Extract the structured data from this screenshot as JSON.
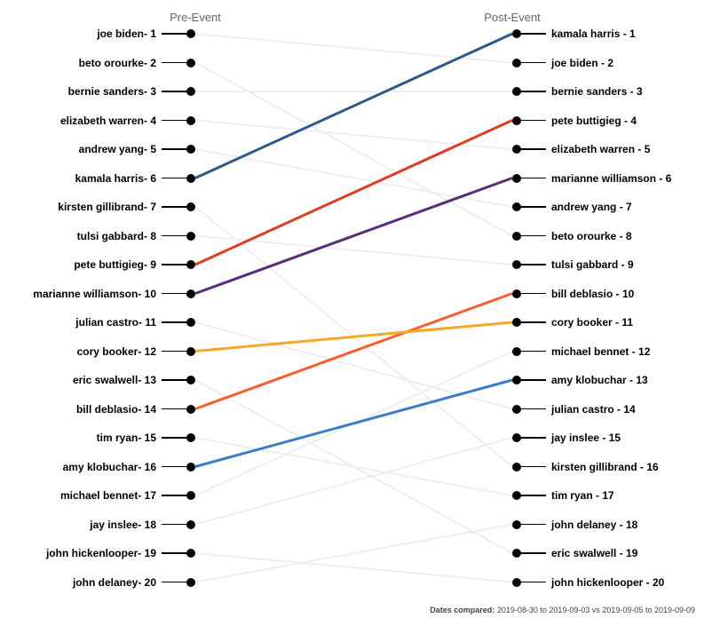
{
  "chart_data": {
    "type": "slope",
    "headers": {
      "pre": "Pre-Event",
      "post": "Post-Event"
    },
    "footer": {
      "label": "Dates compared:",
      "range": "2019-08-30 to 2019-09-03 vs 2019-09-05 to 2019-09-09"
    },
    "layout": {
      "leftX": 220,
      "rightX": 577,
      "topY": 38,
      "gap": 32.5
    },
    "highlights": [
      {
        "name": "kamala harris",
        "from": 6,
        "to": 1,
        "color": "#2d5a8c"
      },
      {
        "name": "pete buttigieg",
        "from": 9,
        "to": 4,
        "color": "#e23b22"
      },
      {
        "name": "marianne williamson",
        "from": 10,
        "to": 6,
        "color": "#5a2d7a"
      },
      {
        "name": "bill deblasio",
        "from": 14,
        "to": 10,
        "color": "#f75f2e"
      },
      {
        "name": "cory booker",
        "from": 12,
        "to": 11,
        "color": "#f7a728"
      },
      {
        "name": "amy klobuchar",
        "from": 16,
        "to": 13,
        "color": "#3b7dc9"
      }
    ],
    "pre": [
      {
        "name": "joe biden",
        "rank": 1
      },
      {
        "name": "beto orourke",
        "rank": 2
      },
      {
        "name": "bernie sanders",
        "rank": 3
      },
      {
        "name": "elizabeth warren",
        "rank": 4
      },
      {
        "name": "andrew yang",
        "rank": 5
      },
      {
        "name": "kamala harris",
        "rank": 6
      },
      {
        "name": "kirsten gillibrand",
        "rank": 7
      },
      {
        "name": "tulsi gabbard",
        "rank": 8
      },
      {
        "name": "pete buttigieg",
        "rank": 9
      },
      {
        "name": "marianne williamson",
        "rank": 10
      },
      {
        "name": "julian castro",
        "rank": 11
      },
      {
        "name": "cory booker",
        "rank": 12
      },
      {
        "name": "eric swalwell",
        "rank": 13
      },
      {
        "name": "bill deblasio",
        "rank": 14
      },
      {
        "name": "tim ryan",
        "rank": 15
      },
      {
        "name": "amy klobuchar",
        "rank": 16
      },
      {
        "name": "michael bennet",
        "rank": 17
      },
      {
        "name": "jay inslee",
        "rank": 18
      },
      {
        "name": "john hickenlooper",
        "rank": 19
      },
      {
        "name": "john delaney",
        "rank": 20
      }
    ],
    "post": [
      {
        "name": "kamala harris",
        "rank": 1
      },
      {
        "name": "joe biden",
        "rank": 2
      },
      {
        "name": "bernie sanders",
        "rank": 3
      },
      {
        "name": "pete buttigieg",
        "rank": 4
      },
      {
        "name": "elizabeth warren",
        "rank": 5
      },
      {
        "name": "marianne williamson",
        "rank": 6
      },
      {
        "name": "andrew yang",
        "rank": 7
      },
      {
        "name": "beto orourke",
        "rank": 8
      },
      {
        "name": "tulsi gabbard",
        "rank": 9
      },
      {
        "name": "bill deblasio",
        "rank": 10
      },
      {
        "name": "cory booker",
        "rank": 11
      },
      {
        "name": "michael bennet",
        "rank": 12
      },
      {
        "name": "amy klobuchar",
        "rank": 13
      },
      {
        "name": "julian castro",
        "rank": 14
      },
      {
        "name": "jay inslee",
        "rank": 15
      },
      {
        "name": "kirsten gillibrand",
        "rank": 16
      },
      {
        "name": "tim ryan",
        "rank": 17
      },
      {
        "name": "john delaney",
        "rank": 18
      },
      {
        "name": "eric swalwell",
        "rank": 19
      },
      {
        "name": "john hickenlooper",
        "rank": 20
      }
    ]
  }
}
